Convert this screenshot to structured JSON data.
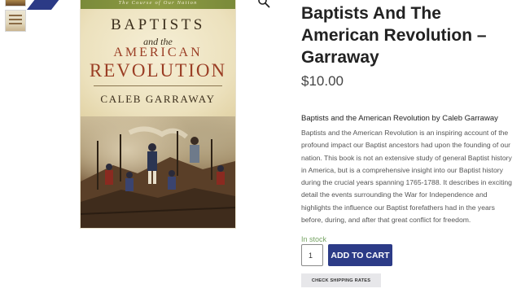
{
  "product": {
    "title": "Baptists And The American Revolution – Garraway",
    "price": "$10.00",
    "description_heading": "Baptists and the American Revolution by Caleb Garraway",
    "description": "Baptists and the American Revolution is an inspiring account of the profound impact our Baptist ancestors had upon the founding of our nation. This book is not an extensive study of general Baptist history in America, but is a comprehensive insight into our Baptist history during the crucial years spanning 1765-1788. It describes in exciting detail the events surrounding the War for Independence and highlights the influence our Baptist forefathers had in the years before, during, and after that great conflict for freedom.",
    "stock_status": "In stock"
  },
  "cart": {
    "quantity": "1",
    "add_to_cart_label": "ADD TO CART",
    "shipping_label": "CHECK SHIPPING RATES"
  },
  "cover": {
    "subtitle_band": "The Course of Our Nation",
    "title_line_1": "BAPTISTS",
    "title_line_2": "and the",
    "title_line_3": "AMERICAN",
    "title_line_4": "REVOLUTION",
    "author": "CALEB GARRAWAY"
  },
  "icons": {
    "zoom": "magnifier-icon"
  },
  "colors": {
    "accent": "#2c3b87",
    "in_stock": "#77a464",
    "title_text": "#222222"
  }
}
